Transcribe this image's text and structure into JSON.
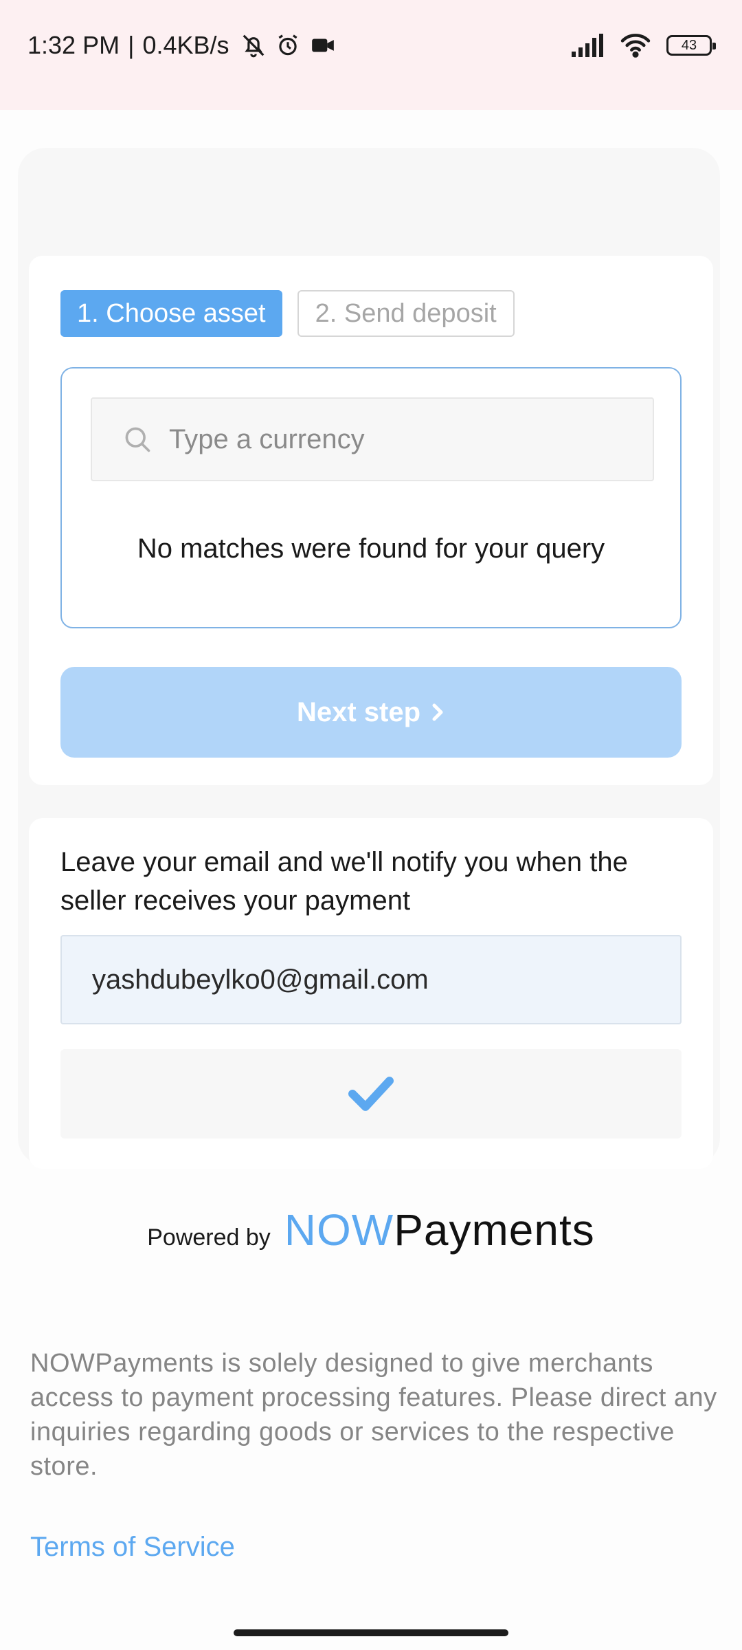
{
  "status_bar": {
    "time": "1:32 PM",
    "separator": "|",
    "net_speed": "0.4KB/s",
    "battery": "43",
    "icons": [
      "bell-off-icon",
      "alarm-icon",
      "video-icon",
      "signal-icon",
      "wifi-icon",
      "battery-icon"
    ]
  },
  "steps": [
    {
      "label": "1. Choose asset",
      "active": true
    },
    {
      "label": "2. Send deposit",
      "active": false
    }
  ],
  "search": {
    "placeholder": "Type a currency",
    "value": "",
    "no_results": "No matches were found for your query"
  },
  "next_button": {
    "label": "Next step",
    "enabled": false
  },
  "notify": {
    "text": "Leave your email and we'll notify you when the seller receives your payment",
    "email": "yashdubeylko0@gmail.com"
  },
  "powered_by": {
    "label": "Powered by",
    "logo_now": "NOW",
    "logo_payments": "Payments"
  },
  "disclaimer": "NOWPayments is solely designed to give merchants access to payment processing features. Please direct any inquiries regarding goods or services to the respective store.",
  "terms_link": "Terms of Service",
  "colors": {
    "accent": "#5ca8f0",
    "button_disabled": "#b1d5f9",
    "status_bar_bg": "#fdf0f2"
  }
}
